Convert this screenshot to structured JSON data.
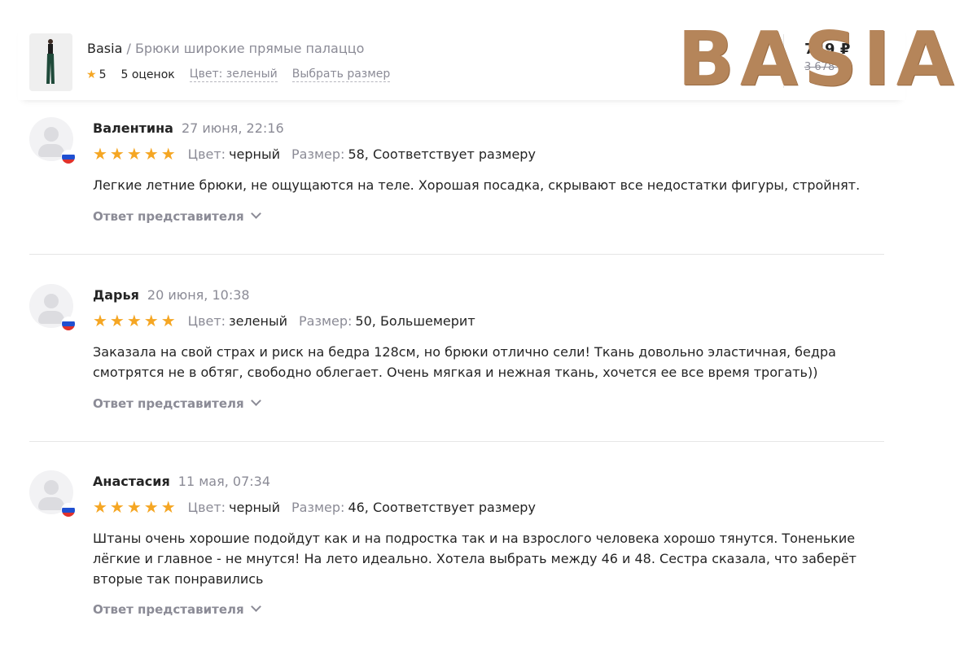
{
  "product": {
    "brand": "Basia",
    "separator": " / ",
    "title": "Брюки широкие прямые палаццо",
    "rating": "5",
    "ratings_count": "5 оценок",
    "color_link": "Цвет: зеленый",
    "size_link": "Выбрать размер",
    "price": "749 ₽",
    "old_price": "3 678 ₽"
  },
  "logo": {
    "letters": [
      "B",
      "A",
      "S",
      "I",
      "A"
    ],
    "color": "#b5855a"
  },
  "reviews": [
    {
      "name": "Валентина",
      "date": "27 июня, 22:16",
      "rating": 5,
      "stars": "★★★★★",
      "color_label": "Цвет:",
      "color_value": "черный",
      "size_label": "Размер:",
      "size_value": "58, Соответствует размеру",
      "text": "Легкие летние брюки, не ощущаются на теле. Хорошая посадка, скрывают все недостатки фигуры, стройнят.",
      "answer_label": "Ответ представителя"
    },
    {
      "name": "Дарья",
      "date": "20 июня, 10:38",
      "rating": 5,
      "stars": "★★★★★",
      "color_label": "Цвет:",
      "color_value": "зеленый",
      "size_label": "Размер:",
      "size_value": "50, Большемерит",
      "text": "Заказала на свой страх и риск на бедра 128см, но брюки отлично сели! Ткань довольно эластичная, бедра смотрятся не в обтяг, свободно облегает. Очень мягкая и нежная ткань, хочется ее все время трогать))",
      "answer_label": "Ответ представителя"
    },
    {
      "name": "Анастасия",
      "date": "11 мая, 07:34",
      "rating": 5,
      "stars": "★★★★★",
      "color_label": "Цвет:",
      "color_value": "черный",
      "size_label": "Размер:",
      "size_value": "46, Соответствует размеру",
      "text": "Штаны очень хорошие подойдут как и на подростка так и на взрослого человека хорошо тянутся. Тоненькие лёгкие и главное - не мнутся! На лето идеально. Хотела выбрать между 46 и 48. Сестра сказала, что заберёт вторые так понравились",
      "answer_label": "Ответ представителя"
    }
  ],
  "colors": {
    "star": "#f5a623",
    "muted": "#8b8b96",
    "text": "#242424"
  }
}
